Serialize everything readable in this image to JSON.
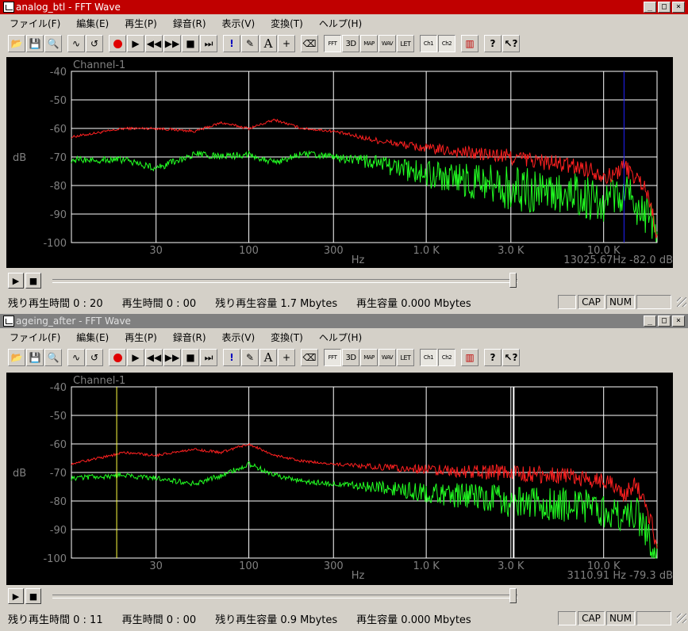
{
  "menu": [
    "ファイル(F)",
    "編集(E)",
    "再生(P)",
    "録音(R)",
    "表示(V)",
    "変換(T)",
    "ヘルプ(H)"
  ],
  "toolbar": {
    "fft": "FFT",
    "three_d": "3D",
    "map": "MAP",
    "wav": "WAV",
    "let": "LET",
    "ch1": "Ch1",
    "ch2": "Ch2"
  },
  "colors": {
    "ch_red": "#ff2020",
    "ch_green": "#22ff22",
    "grid": "#ffffff",
    "axis_text": "#808080",
    "active_title": "#c00000",
    "inactive_title": "#808080"
  },
  "windows": [
    {
      "title": "analog_btl - FFT Wave",
      "active": true,
      "channel_label": "Channel-1",
      "y_axis_label": "dB",
      "x_axis_label": "Hz",
      "cursor_readout": "13025.67Hz  -82.0  dB",
      "cursor_freq": 13025.67,
      "status": {
        "remaining_time": "残り再生時間 0 : 20",
        "play_time": "再生時間 0 : 00",
        "remaining_size": "残り再生容量 1.7 Mbytes",
        "play_size": "再生容量 0.000 Mbytes",
        "cap": "CAP",
        "num": "NUM"
      },
      "chart_data": {
        "type": "line",
        "x_scale": "log",
        "xlim": [
          10,
          20000
        ],
        "ylim": [
          -100,
          -40
        ],
        "y_ticks": [
          "-40",
          "-50",
          "-60",
          "-70",
          "-80",
          "-90",
          "-100"
        ],
        "x_ticks": [
          {
            "label": "30",
            "f": 30
          },
          {
            "label": "100",
            "f": 100
          },
          {
            "label": "300",
            "f": 300
          },
          {
            "label": "1.0 K",
            "f": 1000
          },
          {
            "label": "3.0 K",
            "f": 3000
          },
          {
            "label": "10.0 K",
            "f": 10000
          }
        ],
        "series": [
          {
            "color": "red",
            "x": [
              10,
              20,
              30,
              50,
              70,
              100,
              140,
              200,
              300,
              500,
              1000,
              2000,
              3000,
              5000,
              8000,
              11000,
              13000,
              15000,
              17000,
              19000,
              20000
            ],
            "y": [
              -63,
              -60,
              -60,
              -61,
              -58,
              -60,
              -57,
              -60,
              -61,
              -64,
              -67,
              -69,
              -70,
              -72,
              -74,
              -77,
              -73,
              -77,
              -80,
              -90,
              -98
            ],
            "noise": 3
          },
          {
            "color": "green",
            "x": [
              10,
              20,
              30,
              50,
              70,
              100,
              140,
              200,
              300,
              500,
              1000,
              2000,
              3000,
              5000,
              8000,
              11000,
              13000,
              15000,
              17000,
              19000,
              20000
            ],
            "y": [
              -71,
              -71,
              -74,
              -69,
              -70,
              -69,
              -72,
              -69,
              -70,
              -72,
              -76,
              -79,
              -81,
              -83,
              -84,
              -86,
              -82,
              -86,
              -90,
              -95,
              -99
            ],
            "noise": 8
          }
        ]
      }
    },
    {
      "title": "ageing_after - FFT Wave",
      "active": false,
      "channel_label": "Channel-1",
      "y_axis_label": "dB",
      "x_axis_label": "Hz",
      "cursor_readout": "3110.91 Hz  -79.3  dB",
      "cursor_freq": 3110.91,
      "marker_freq": 18,
      "status": {
        "remaining_time": "残り再生時間 0 : 11",
        "play_time": "再生時間 0 : 00",
        "remaining_size": "残り再生容量 0.9 Mbytes",
        "play_size": "再生容量 0.000 Mbytes",
        "cap": "CAP",
        "num": "NUM"
      },
      "chart_data": {
        "type": "line",
        "x_scale": "log",
        "xlim": [
          10,
          20000
        ],
        "ylim": [
          -100,
          -40
        ],
        "y_ticks": [
          "-40",
          "-50",
          "-60",
          "-70",
          "-80",
          "-90",
          "-100"
        ],
        "x_ticks": [
          {
            "label": "30",
            "f": 30
          },
          {
            "label": "100",
            "f": 100
          },
          {
            "label": "300",
            "f": 300
          },
          {
            "label": "1.0 K",
            "f": 1000
          },
          {
            "label": "3.0 K",
            "f": 3000
          },
          {
            "label": "10.0 K",
            "f": 10000
          }
        ],
        "series": [
          {
            "color": "red",
            "x": [
              10,
              20,
              30,
              50,
              70,
              100,
              140,
              200,
              300,
              500,
              1000,
              2000,
              3000,
              5000,
              8000,
              11000,
              13000,
              15000,
              17000,
              19000,
              20000
            ],
            "y": [
              -67,
              -63,
              -64,
              -62,
              -63,
              -60,
              -64,
              -66,
              -67,
              -68,
              -69,
              -70,
              -70,
              -71,
              -72,
              -74,
              -78,
              -74,
              -80,
              -90,
              -99
            ],
            "noise": 3
          },
          {
            "color": "green",
            "x": [
              10,
              20,
              30,
              50,
              70,
              100,
              140,
              200,
              300,
              500,
              1000,
              2000,
              3000,
              5000,
              8000,
              11000,
              13000,
              15000,
              17000,
              19000,
              20000
            ],
            "y": [
              -72,
              -71,
              -72,
              -74,
              -71,
              -67,
              -71,
              -73,
              -74,
              -75,
              -77,
              -79,
              -80,
              -81,
              -82,
              -84,
              -88,
              -83,
              -90,
              -95,
              -100
            ],
            "noise": 6
          }
        ]
      }
    }
  ]
}
